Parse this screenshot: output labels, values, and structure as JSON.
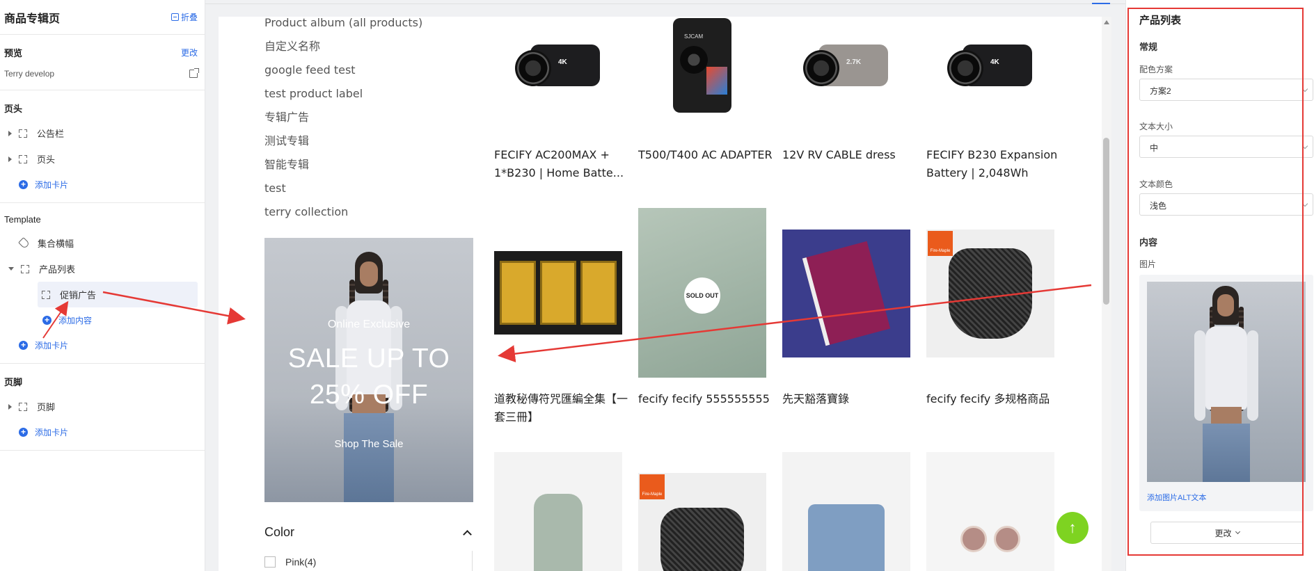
{
  "left_panel": {
    "title": "商品专辑页",
    "fold_label": "折叠",
    "preview": {
      "heading": "预览",
      "change_link": "更改",
      "site_name": "Terry develop"
    },
    "header_section": {
      "heading": "页头",
      "items": [
        {
          "label": "公告栏"
        },
        {
          "label": "页头"
        }
      ],
      "add_card": "添加卡片"
    },
    "template_section": {
      "heading": "Template",
      "items": [
        {
          "label": "集合横幅"
        },
        {
          "label": "产品列表"
        }
      ],
      "sub_item": "促销广告",
      "add_content": "添加内容",
      "add_card": "添加卡片"
    },
    "footer_section": {
      "heading": "页脚",
      "items": [
        {
          "label": "页脚"
        }
      ],
      "add_card": "添加卡片"
    }
  },
  "preview_canvas": {
    "categories": [
      "Product album (all products)",
      "自定义名称",
      "google feed test",
      "test product label",
      "专辑广告",
      "测试专辑",
      "智能专辑",
      "test",
      "terry collection"
    ],
    "promo": {
      "line1": "Online Exclusive",
      "line2": "SALE UP TO",
      "line3": "25% OFF",
      "line4": "Shop The Sale"
    },
    "color_filter": {
      "heading": "Color",
      "options": [
        "Pink(4)"
      ]
    },
    "products_row1": [
      {
        "name": "FECIFY AC200MAX + 1*B230 | Home Batte...",
        "cam_label": "4K"
      },
      {
        "name": "T500/T400 AC ADAPTER",
        "cam_label": "SJCAM"
      },
      {
        "name": "12V RV CABLE dress",
        "cam_label": "2.7K"
      },
      {
        "name": "FECIFY B230 Expansion Battery | 2,048Wh",
        "cam_label": "4K"
      }
    ],
    "products_row2": [
      {
        "name": "道教秘傳符咒匯編全集【一套三冊】"
      },
      {
        "name": "fecify fecify 555555555",
        "sold_out": "SOLD OUT"
      },
      {
        "name": "先天豁落寶錄"
      },
      {
        "name": "fecify fecify 多规格商品",
        "badge": "Fire-Maple"
      }
    ],
    "products_row3_badge": "Fire-Maple",
    "to_top_icon": "arrow-up-icon"
  },
  "right_panel": {
    "title": "产品列表",
    "general_heading": "常规",
    "color_scheme": {
      "label": "配色方案",
      "value": "方案2"
    },
    "text_size": {
      "label": "文本大小",
      "value": "中"
    },
    "text_color": {
      "label": "文本颜色",
      "value": "浅色"
    },
    "content_heading": "内容",
    "image_label": "图片",
    "alt_link": "添加图片ALT文本",
    "change_button": "更改"
  },
  "colors": {
    "accent": "#2b6be6",
    "annotation": "#e53935",
    "to_top": "#7ed321"
  }
}
